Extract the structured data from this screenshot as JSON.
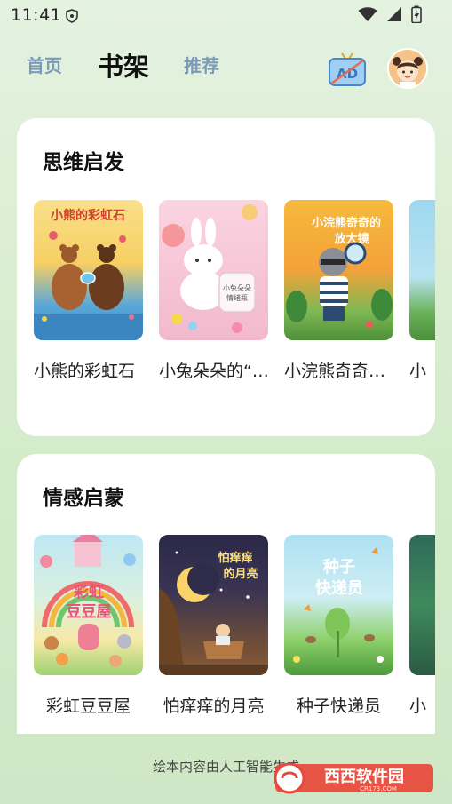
{
  "status": {
    "time": "11:41"
  },
  "nav": {
    "tabs": [
      {
        "label": "首页"
      },
      {
        "label": "书架"
      },
      {
        "label": "推荐"
      }
    ],
    "ad_label": "AD"
  },
  "sections": [
    {
      "title": "思维启发",
      "books": [
        {
          "title": "小熊的彩虹石",
          "cover_text": "小熊的彩虹石"
        },
        {
          "title": "小兔朵朵的“…",
          "cover_text": "小兔朵朵情绪瓶"
        },
        {
          "title": "小浣熊奇奇…",
          "cover_text": "小浣熊奇奇的放大镜"
        },
        {
          "title": "小"
        }
      ]
    },
    {
      "title": "情感启蒙",
      "books": [
        {
          "title": "彩虹豆豆屋",
          "cover_text": "彩虹豆豆屋"
        },
        {
          "title": "怕痒痒的月亮",
          "cover_text": "怕痒痒的月亮"
        },
        {
          "title": "种子快递员",
          "cover_text": "种子快递员"
        },
        {
          "title": "小"
        }
      ]
    }
  ],
  "footer": {
    "text": "绘本内容由人工智能生成"
  },
  "watermark": {
    "text": "西西软件园",
    "sub": "CR173.COM"
  }
}
